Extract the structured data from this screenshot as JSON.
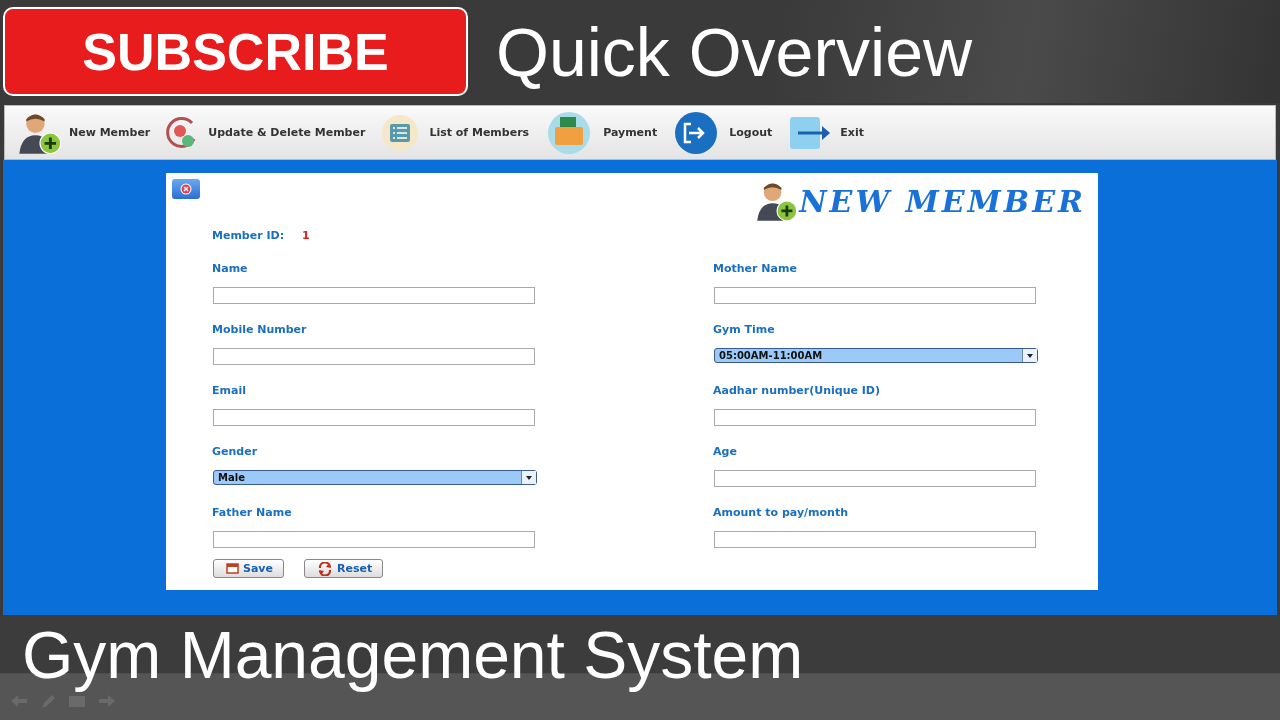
{
  "banner": {
    "subscribe": "SUBSCRIBE",
    "title": "Quick Overview"
  },
  "toolbar": [
    {
      "label": "New Member",
      "kind": "add-user"
    },
    {
      "label": "Update & Delete Member",
      "kind": "update"
    },
    {
      "label": "List of Members",
      "kind": "list"
    },
    {
      "label": "Payment",
      "kind": "payment"
    },
    {
      "label": "Logout",
      "kind": "logout"
    },
    {
      "label": "Exit",
      "kind": "exit"
    }
  ],
  "form": {
    "title": "NEW MEMBER",
    "member_id_label": "Member ID:",
    "member_id": "1",
    "left": [
      {
        "label": "Name",
        "kind": "text"
      },
      {
        "label": "Mobile Number",
        "kind": "text"
      },
      {
        "label": "Email",
        "kind": "text"
      },
      {
        "label": "Gender",
        "kind": "select",
        "value": "Male"
      },
      {
        "label": "Father Name",
        "kind": "text"
      }
    ],
    "right": [
      {
        "label": "Mother Name",
        "kind": "text"
      },
      {
        "label": "Gym Time",
        "kind": "select",
        "value": "05:00AM-11:00AM"
      },
      {
        "label": "Aadhar number(Unique ID)",
        "kind": "text"
      },
      {
        "label": "Age",
        "kind": "text"
      },
      {
        "label": "Amount to pay/month",
        "kind": "text"
      }
    ],
    "buttons": [
      {
        "label": "Save",
        "kind": "save"
      },
      {
        "label": "Reset",
        "kind": "reset"
      }
    ]
  },
  "footer": {
    "title": "Gym Management System"
  }
}
